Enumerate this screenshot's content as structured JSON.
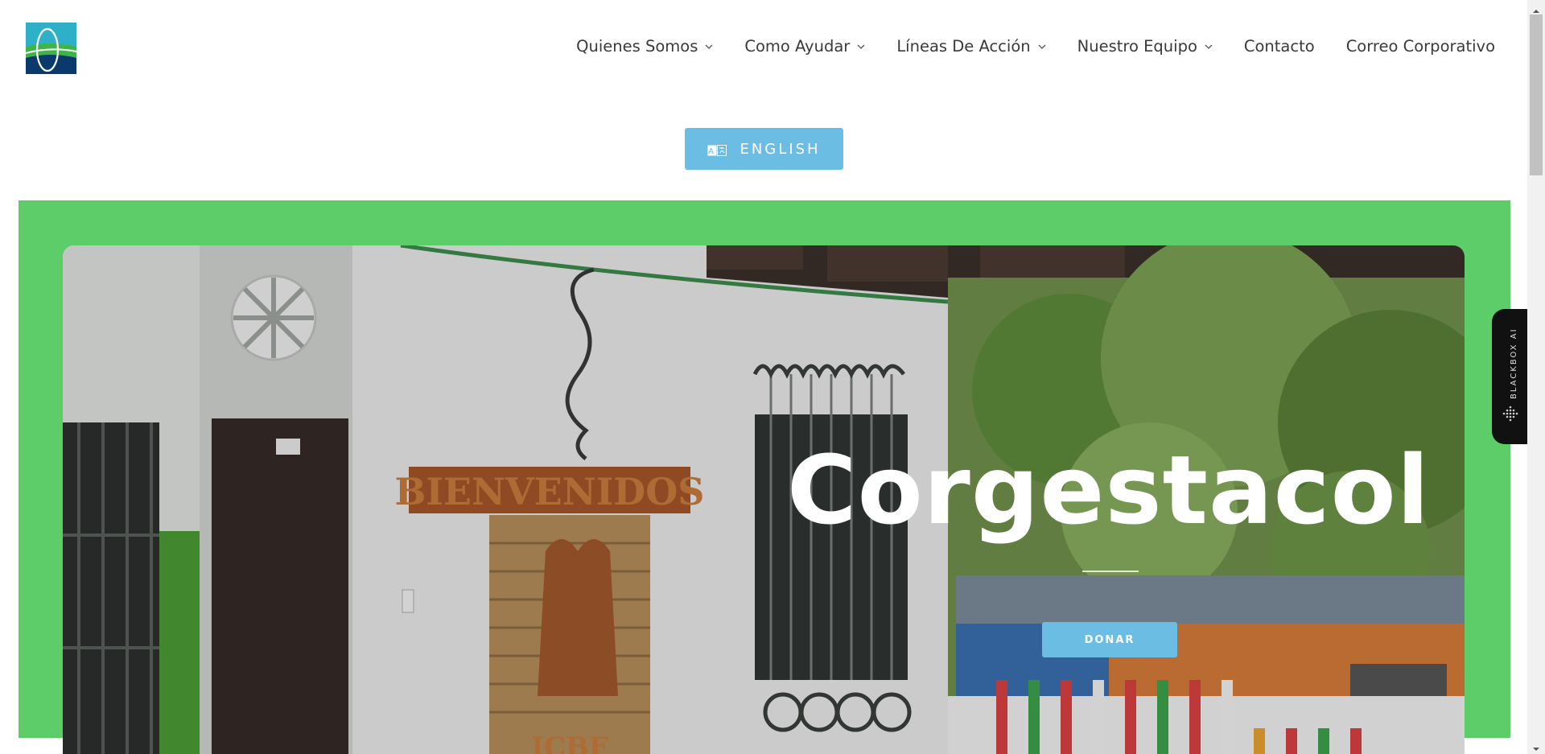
{
  "brand": {
    "accent": "#6bbde3",
    "green": "#5dcd6a",
    "logo_icon": "organization-logo"
  },
  "nav": {
    "items": [
      {
        "label": "Quienes Somos",
        "has_dropdown": true
      },
      {
        "label": "Como Ayudar",
        "has_dropdown": true
      },
      {
        "label": "Líneas De Acción",
        "has_dropdown": true
      },
      {
        "label": "Nuestro Equipo",
        "has_dropdown": true
      },
      {
        "label": "Contacto",
        "has_dropdown": false
      },
      {
        "label": "Correo Corporativo",
        "has_dropdown": false
      }
    ]
  },
  "language": {
    "label": "ENGLISH",
    "icon": "translate-icon"
  },
  "hero": {
    "title": "Corgestacol",
    "donate_label": "DONAR",
    "sign_text": "BIENVENIDOS",
    "sign_bottom": "ICBF"
  },
  "side_widget": {
    "label": "BLACKBOX AI"
  }
}
